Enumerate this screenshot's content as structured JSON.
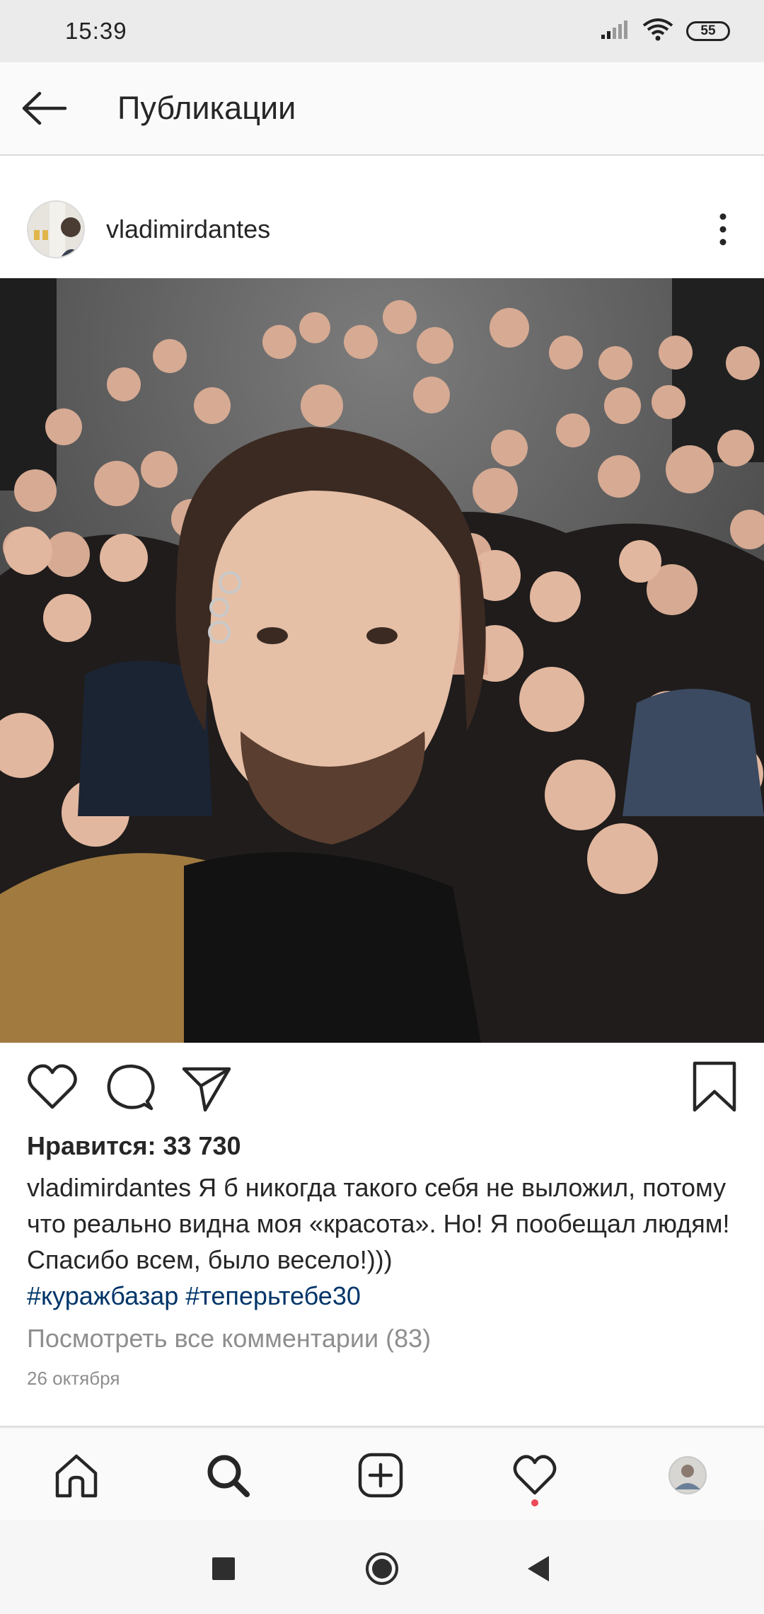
{
  "status_bar": {
    "time": "15:39",
    "battery_level": "55",
    "icons": [
      "signal-icon",
      "wifi-icon",
      "battery-icon"
    ]
  },
  "header": {
    "title": "Публикации",
    "back_icon": "arrow-left-icon"
  },
  "post": {
    "username": "vladimirdantes",
    "avatar_icon": "profile-avatar",
    "more_icon": "more-vertical-icon",
    "photo_icon": "group-selfie-photo",
    "likes_text": "Нравится: 33 730",
    "caption": {
      "username": "vladimirdantes",
      "text": "Я б никогда такого себя не выложил, потому что реально видна моя «красота». Но! Я пообещал людям! Спасибо всем, было весело!)))",
      "hashtags": [
        "#куражбазар",
        "#теперьтебе30"
      ]
    },
    "view_comments_text": "Посмотреть все комментарии (83)",
    "date": "26 октября"
  },
  "actions": [
    "like-icon",
    "comment-icon",
    "share-icon",
    "bookmark-icon"
  ],
  "bottom_nav": [
    "home-icon",
    "search-icon",
    "add-post-icon",
    "activity-heart-icon",
    "profile-icon"
  ],
  "system_nav": [
    "recent-apps-icon",
    "home-button-icon",
    "back-button-icon"
  ],
  "colors": {
    "hashtag": "#003569",
    "secondary_text": "#8e8e8e",
    "notification_dot": "#ed4956"
  }
}
